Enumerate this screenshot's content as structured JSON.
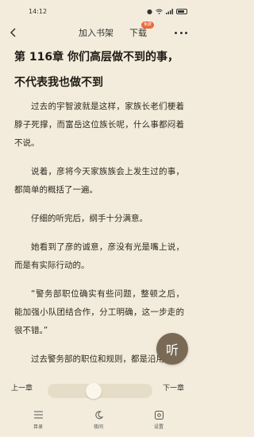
{
  "status_bar": {
    "time": "14:12",
    "icons": [
      "notification-icon",
      "wifi-icon",
      "signal-icon",
      "battery-icon"
    ]
  },
  "top_bar": {
    "add_shelf_label": "加入书架",
    "download_label": "下载",
    "free_badge": "免费"
  },
  "chapter": {
    "title": "第 116章 你们高层做不到的事，不代表我也做不到",
    "paragraphs": [
      "过去的宇智波就是这样，家族长老们梗着脖子死撑，而富岳这位族长呢，什么事都闷着不说。",
      "说着，彦将今天家族族会上发生过的事，都简单的概括了一遍。",
      "仔细的听完后，纲手十分满意。",
      "她看到了彦的诚意，彦没有光是嘴上说，而是有实际行动的。",
      "“警务部职位确实有些问题，整顿之后，能加强小队团结合作，分工明确，这一步走的很不错。”",
      "过去警务部的职位和规则，都是沿用"
    ]
  },
  "listen_button": {
    "label": "听"
  },
  "bottom_panel": {
    "prev_label": "上一章",
    "next_label": "下一章",
    "progress": 0.44,
    "menu": [
      {
        "label": "目录",
        "icon": "catalog-icon"
      },
      {
        "label": "夜间",
        "icon": "moon-icon"
      },
      {
        "label": "设置",
        "icon": "settings-icon"
      }
    ]
  }
}
